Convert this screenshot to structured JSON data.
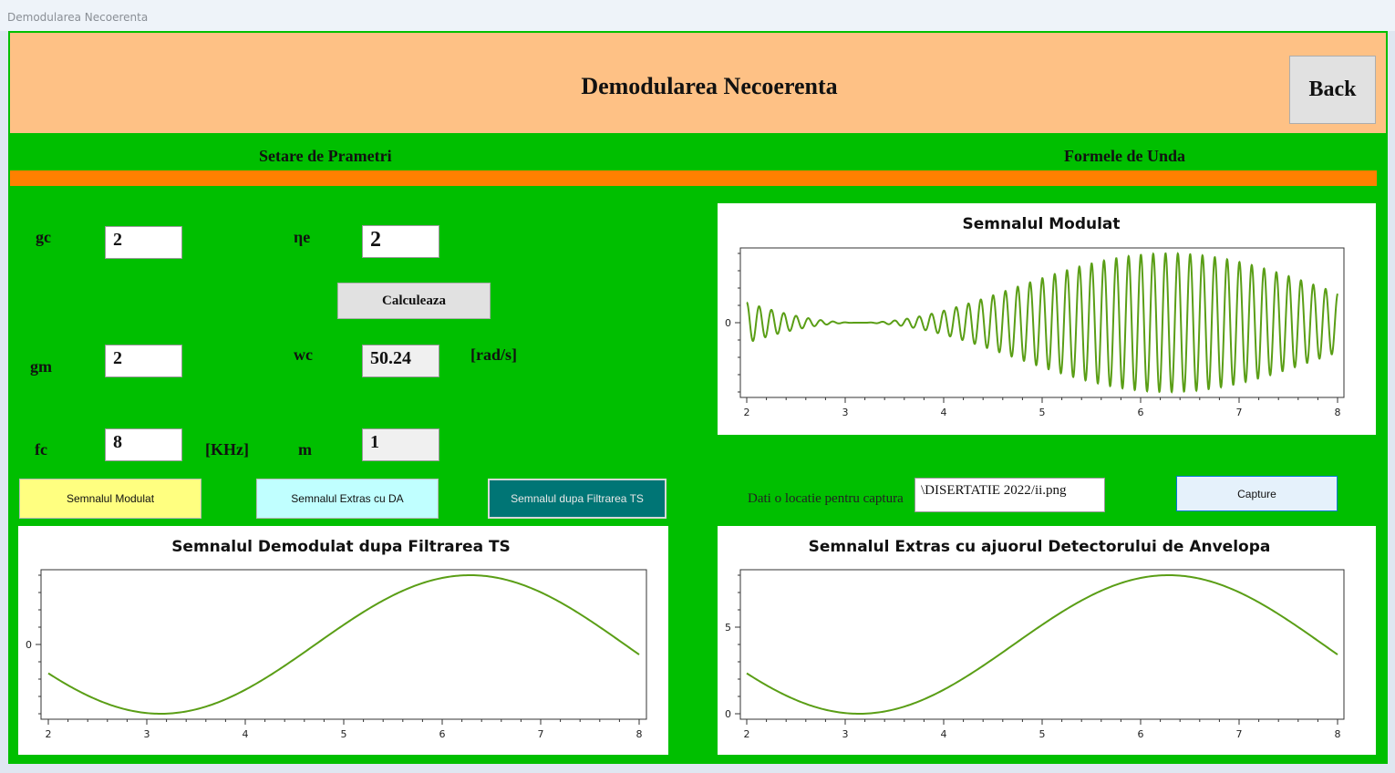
{
  "window": {
    "title": "Demodularea Necoerenta"
  },
  "header": {
    "title": "Demodularea Necoerenta",
    "back_label": "Back"
  },
  "sections": {
    "left": "Setare de Prametri",
    "right": "Formele de Unda"
  },
  "params": {
    "gc": {
      "label": "gc",
      "value": "2"
    },
    "ne": {
      "label": "ηe",
      "value": "2"
    },
    "gm": {
      "label": "gm",
      "value": "2"
    },
    "wc": {
      "label": "wc",
      "value": "50.24",
      "unit": "[rad/s]"
    },
    "fc": {
      "label": "fc",
      "value": "8",
      "unit": "[KHz]"
    },
    "m": {
      "label": "m",
      "value": "1"
    }
  },
  "buttons": {
    "calculate": "Calculeaza",
    "modulated": "Semnalul Modulat",
    "extracted": "Semnalul Extras cu DA",
    "filtered": "Semnalul dupa Filtrarea TS",
    "capture": "Capture"
  },
  "capture": {
    "label": "Dati o locatie pentru captura",
    "path": "\\DISERTATIE 2022/ii.png"
  },
  "colors": {
    "background": "#00bf00",
    "header": "#fec185",
    "divider": "#ff8000",
    "line": "#5a9e16",
    "modulated_btn": "#ffff80",
    "extracted_btn": "#c0ffff",
    "filtered_btn": "#007575"
  },
  "chart_data": [
    {
      "type": "line",
      "title": "Semnalul Modulat",
      "x_ticks": [
        "2",
        "3",
        "4",
        "5",
        "6",
        "7",
        "8"
      ],
      "y_ticks": [
        "0"
      ],
      "xlim": [
        2,
        8
      ],
      "series": [
        {
          "function": "(1 + cos(t)) * cos(50.24 * t)",
          "x_range": [
            2,
            8
          ]
        }
      ]
    },
    {
      "type": "line",
      "title": "Semnalul Demodulat dupa Filtrarea TS",
      "x_ticks": [
        "2",
        "3",
        "4",
        "5",
        "6",
        "7",
        "8"
      ],
      "y_ticks": [
        "0"
      ],
      "xlim": [
        2,
        8
      ],
      "series": [
        {
          "function": "cos(t)",
          "x_range": [
            2,
            8
          ]
        }
      ]
    },
    {
      "type": "line",
      "title": "Semnalul Extras cu ajuorul Detectorului de Anvelopa",
      "x_ticks": [
        "2",
        "3",
        "4",
        "5",
        "6",
        "7",
        "8"
      ],
      "y_ticks": [
        "0",
        "5"
      ],
      "xlim": [
        2,
        8
      ],
      "ylim": [
        0,
        8
      ],
      "series": [
        {
          "function": "4 * (1 + cos(t))",
          "x_range": [
            2,
            8
          ]
        }
      ]
    }
  ]
}
